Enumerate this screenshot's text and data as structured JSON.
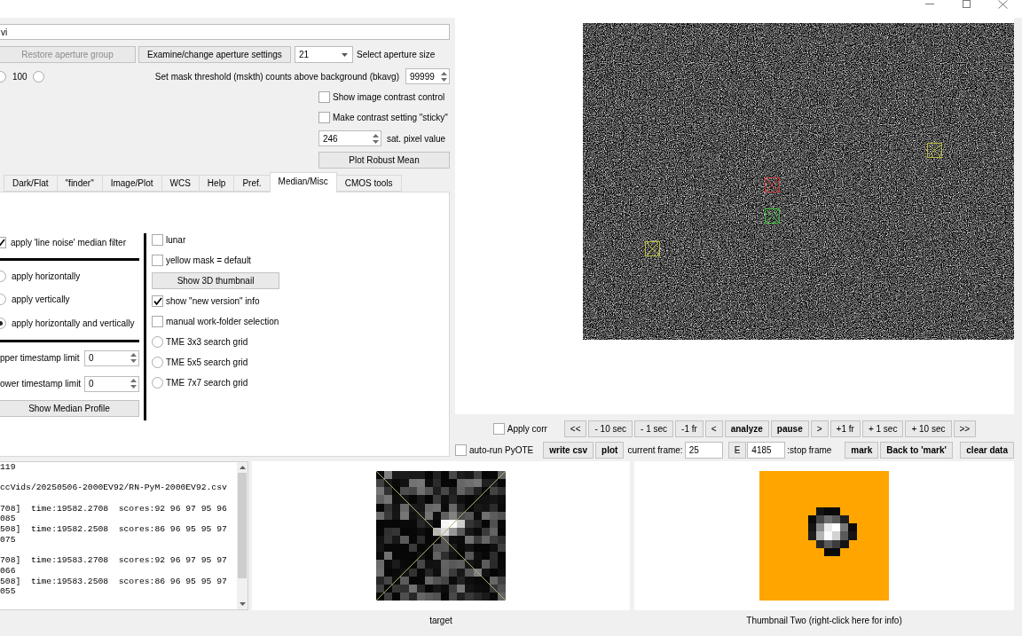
{
  "file_path": {
    "value": "vi"
  },
  "aperture_controls": {
    "restore_button": {
      "label": "Restore aperture group",
      "disabled": true
    },
    "settings_button": {
      "label": "Examine/change aperture settings"
    },
    "size_combo": {
      "value": "21"
    },
    "size_label": "Select aperture size"
  },
  "mask_radios": [
    {
      "selected": false
    },
    {
      "label": "100",
      "selected": false
    }
  ],
  "mask_threshold": {
    "label": "Set mask threshold (mskth) counts above background (bkavg)",
    "value": "99999"
  },
  "contrast_options": [
    {
      "label": "Show image contrast control",
      "checked": false
    },
    {
      "label": "Make contrast setting \"sticky\"",
      "checked": false
    }
  ],
  "sat_pixel": {
    "value": "246",
    "label": "sat. pixel value"
  },
  "robust_mean_button": {
    "label": "Plot Robust Mean"
  },
  "tabs": [
    {
      "label": "Dark/Flat",
      "selected": false
    },
    {
      "label": "\"finder\"",
      "selected": false
    },
    {
      "label": "Image/Plot",
      "selected": false
    },
    {
      "label": "WCS",
      "selected": false
    },
    {
      "label": "Help",
      "selected": false
    },
    {
      "label": "Pref.",
      "selected": false
    },
    {
      "label": "Median/Misc",
      "selected": true
    },
    {
      "label": "CMOS tools",
      "selected": false
    }
  ],
  "median_filter": {
    "line_noise": {
      "label": "apply 'line noise' median filter",
      "checked": true
    },
    "directions": [
      {
        "label": "apply horizontally",
        "selected": false
      },
      {
        "label": "apply vertically",
        "selected": false
      },
      {
        "label": "apply horizontally and vertically",
        "selected": true
      }
    ],
    "timestamp_limits": [
      {
        "label": "pper timestamp limit",
        "value": "0"
      },
      {
        "label": "ower timestamp limit",
        "value": "0"
      }
    ],
    "profile_button": {
      "label": "Show Median Profile"
    }
  },
  "misc_options": [
    {
      "kind": "checkbox",
      "label": "lunar",
      "checked": false
    },
    {
      "kind": "checkbox",
      "label": "yellow mask = default",
      "checked": false
    },
    {
      "kind": "button",
      "label": "Show 3D thumbnail"
    },
    {
      "kind": "checkbox",
      "label": "show \"new version\" info",
      "checked": true
    },
    {
      "kind": "checkbox",
      "label": "manual work-folder selection",
      "checked": false
    },
    {
      "kind": "radio",
      "label": "TME 3x3 search grid",
      "selected": false
    },
    {
      "kind": "radio",
      "label": "TME 5x5 search grid",
      "selected": false
    },
    {
      "kind": "radio",
      "label": "TME 7x7 search grid",
      "selected": false
    }
  ],
  "video_frame": {
    "apertures": [
      {
        "color": "#bcbc3a"
      },
      {
        "color": "#d83c3c"
      },
      {
        "color": "#3cc43c"
      },
      {
        "color": "#bcbc3a"
      }
    ]
  },
  "playback_row": [
    {
      "kind": "checkbox",
      "label": "Apply corr",
      "checked": false
    },
    {
      "kind": "button",
      "label": "<<",
      "bold": false
    },
    {
      "kind": "button",
      "label": "- 10 sec",
      "bold": false
    },
    {
      "kind": "button",
      "label": "- 1 sec",
      "bold": false
    },
    {
      "kind": "button",
      "label": "-1 fr",
      "bold": false
    },
    {
      "kind": "button",
      "label": "<",
      "bold": false
    },
    {
      "kind": "button",
      "label": "analyze",
      "bold": true
    },
    {
      "kind": "button",
      "label": "pause",
      "bold": true
    },
    {
      "kind": "button",
      "label": ">",
      "bold": false
    },
    {
      "kind": "button",
      "label": "+1 fr",
      "bold": false
    },
    {
      "kind": "button",
      "label": "+ 1 sec",
      "bold": false
    },
    {
      "kind": "button",
      "label": "+ 10 sec",
      "bold": false
    },
    {
      "kind": "button",
      "label": ">>",
      "bold": false
    }
  ],
  "frame_row": [
    {
      "kind": "checkbox",
      "label": "auto-run PyOTE",
      "checked": false
    },
    {
      "kind": "button",
      "label": "write csv",
      "bold": true
    },
    {
      "kind": "button",
      "label": "plot",
      "bold": true
    },
    {
      "kind": "label",
      "text": "current frame:"
    },
    {
      "kind": "field",
      "value": "25"
    },
    {
      "kind": "button",
      "label": "E",
      "bold": false
    },
    {
      "kind": "field",
      "value": "4185"
    },
    {
      "kind": "label",
      "text": ":stop frame"
    },
    {
      "kind": "button",
      "label": "mark",
      "bold": true
    },
    {
      "kind": "button",
      "label": "Back to 'mark'",
      "bold": true
    },
    {
      "kind": "button",
      "label": "clear data",
      "bold": true
    }
  ],
  "log": {
    "blocks": [
      [
        "119"
      ],
      [
        "ccVids/20250506-2000EV92/RN-PyM-2000EV92.csv"
      ],
      [
        "708]  time:19582.2708  scores:92 96 97 95 96",
        "085",
        "508]  time:19582.2508  scores:86 96 95 95 97",
        "075"
      ],
      [
        "708]  time:19583.2708  scores:92 96 97 95 97",
        "066",
        "508]  time:19583.2508  scores:86 96 95 95 97",
        "055"
      ]
    ]
  },
  "thumbnails": [
    {
      "kind": "target",
      "caption": "target"
    },
    {
      "kind": "star",
      "caption": "Thumbnail Two (right-click here for info)"
    }
  ]
}
